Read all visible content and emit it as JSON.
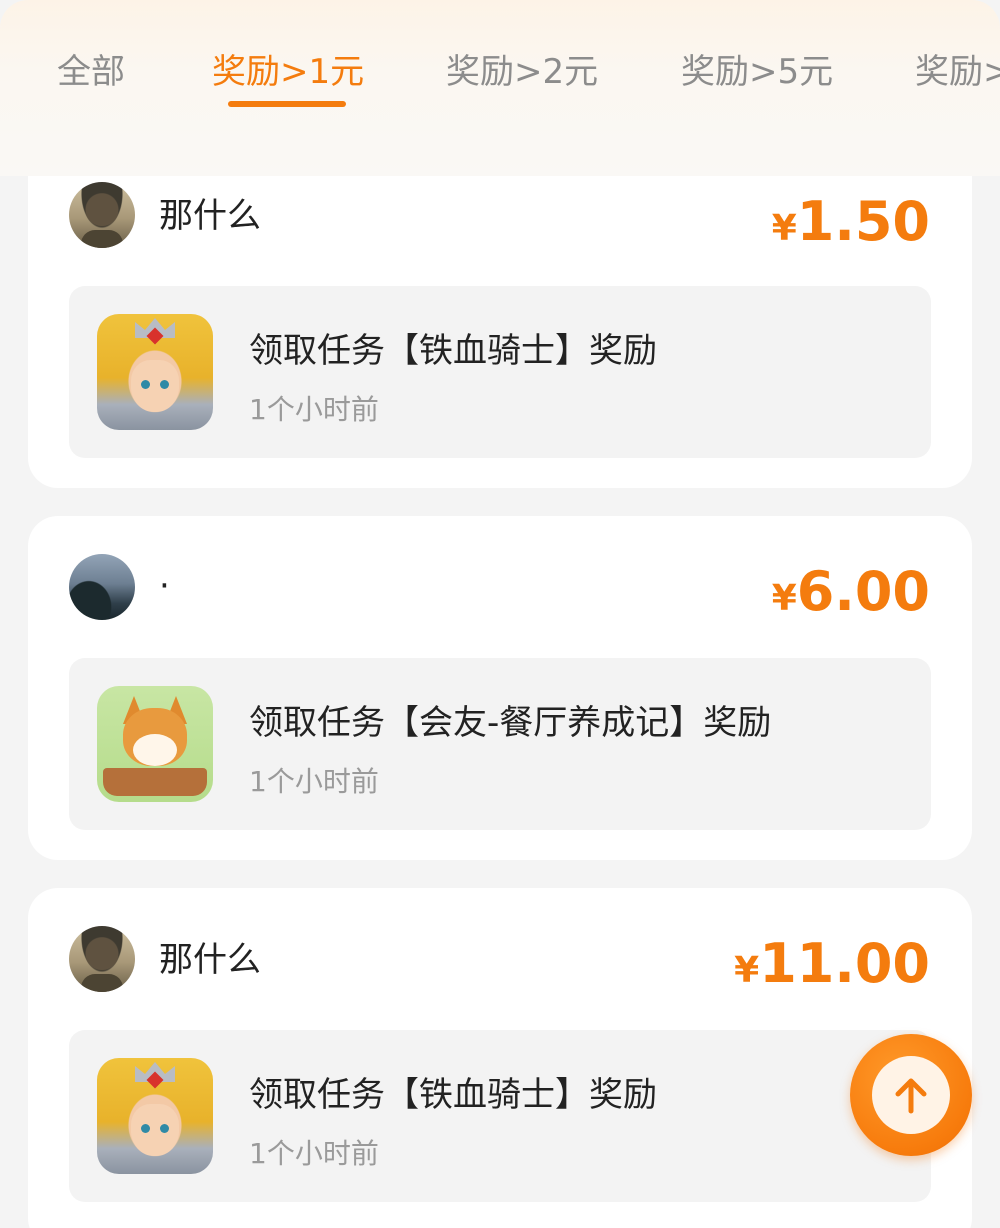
{
  "tabs": [
    {
      "label": "全部",
      "active": false
    },
    {
      "label": "奖励>1元",
      "active": true
    },
    {
      "label": "奖励>2元",
      "active": false
    },
    {
      "label": "奖励>5元",
      "active": false
    },
    {
      "label": "奖励>",
      "active": false
    }
  ],
  "accent_color": "#f47c0e",
  "records": [
    {
      "user": {
        "name": "那什么",
        "avatar": "soldier-avatar"
      },
      "amount": {
        "currency": "¥",
        "value": "1.50"
      },
      "task": {
        "title": "领取任务【铁血骑士】奖励",
        "time": "1个小时前",
        "app_icon": "knight-game-icon"
      }
    },
    {
      "user": {
        "name": "·",
        "avatar": "landscape-avatar"
      },
      "amount": {
        "currency": "¥",
        "value": "6.00"
      },
      "task": {
        "title": "领取任务【会友-餐厅养成记】奖励",
        "time": "1个小时前",
        "app_icon": "corgi-game-icon"
      }
    },
    {
      "user": {
        "name": "那什么",
        "avatar": "soldier-avatar"
      },
      "amount": {
        "currency": "¥",
        "value": "11.00"
      },
      "task": {
        "title": "领取任务【铁血骑士】奖励",
        "time": "1个小时前",
        "app_icon": "knight-game-icon"
      }
    }
  ],
  "back_to_top": {
    "icon": "arrow-up-icon"
  }
}
